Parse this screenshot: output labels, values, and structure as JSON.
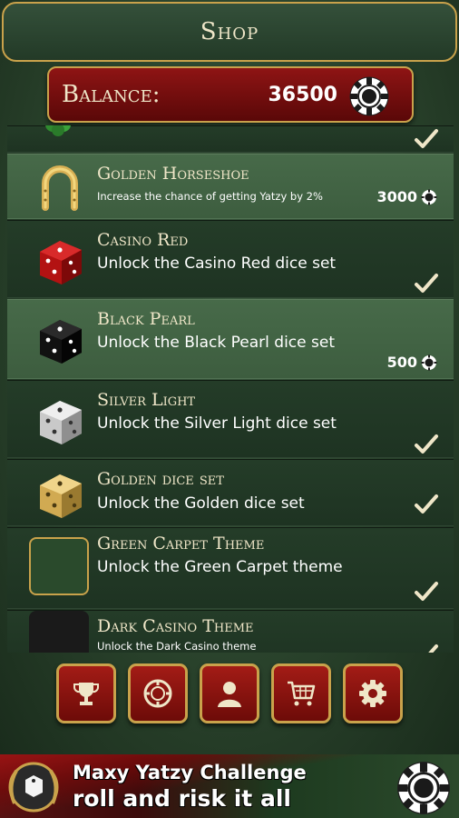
{
  "header": {
    "title": "Shop"
  },
  "balance": {
    "label": "Balance:",
    "value": "36500"
  },
  "items": [
    {
      "title": "",
      "desc": "",
      "owned": true,
      "price": ""
    },
    {
      "title": "Golden Horseshoe",
      "desc": "Increase the chance of getting Yatzy by 2%",
      "owned": false,
      "price": "3000"
    },
    {
      "title": "Casino Red",
      "desc": "Unlock the Casino Red dice set",
      "owned": true,
      "price": ""
    },
    {
      "title": "Black Pearl",
      "desc": "Unlock the Black Pearl dice set",
      "owned": false,
      "price": "500"
    },
    {
      "title": "Silver Light",
      "desc": "Unlock the Silver Light dice set",
      "owned": true,
      "price": ""
    },
    {
      "title": "Golden dice set",
      "desc": "Unlock the Golden dice set",
      "owned": true,
      "price": ""
    },
    {
      "title": "Green Carpet Theme",
      "desc": "Unlock the Green Carpet theme",
      "owned": true,
      "price": ""
    },
    {
      "title": "Dark Casino Theme",
      "desc": "Unlock the Dark Casino theme",
      "owned": true,
      "price": ""
    }
  ],
  "nav": [
    {
      "icon": "trophy-icon"
    },
    {
      "icon": "chip-icon"
    },
    {
      "icon": "profile-icon"
    },
    {
      "icon": "cart-icon"
    },
    {
      "icon": "gear-icon"
    }
  ],
  "banner": {
    "line1": "Maxy Yatzy Challenge",
    "line2": "roll and risk it all"
  },
  "colors": {
    "gold": "#c9a24b",
    "red": "#8e1414",
    "green": "#2a432c",
    "cream": "#efe6c8"
  }
}
